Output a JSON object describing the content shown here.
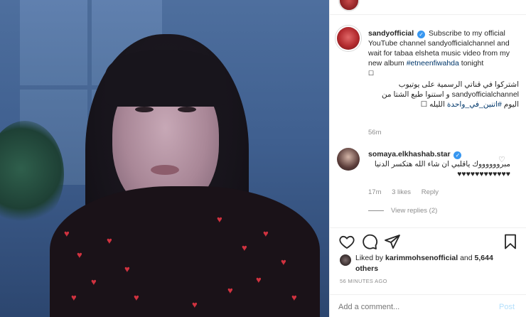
{
  "post": {
    "username": "sandyofficial",
    "caption_en": "Subscribe to my official YouTube channel sandyofficialchannel and wait for tabaa elsheta music video from my new album",
    "caption_hashtag": "#etneenfiwahda",
    "caption_after": "tonight",
    "box_glyph": "☐",
    "caption_ar_1": "اشتركوا في قناتي الرسمية على يوتيوب",
    "caption_ar_2": "sandyofficialchannel و استنوا طبع الشتا من",
    "caption_ar_3": "اليوم",
    "caption_ar_hashtag": "#اتنين_في_واحدة",
    "caption_ar_4": "الليله",
    "time_ago": "56m"
  },
  "comment": {
    "username": "somaya.elkhashab.star",
    "text": "مبرووووووك ياقلبي ان شاء الله هتكسر الدنيا",
    "hearts": "♥♥♥♥♥♥♥♥♥♥♥♥",
    "time": "17m",
    "likes": "3 likes",
    "reply": "Reply",
    "view_replies": "View replies (2)"
  },
  "likes": {
    "prefix": "Liked by",
    "user": "karimmohsenofficial",
    "and": "and",
    "others": "5,644 others"
  },
  "post_time": "56 MINUTES AGO",
  "add_comment": {
    "placeholder": "Add a comment...",
    "post_label": "Post"
  },
  "icons": {
    "like": "heart-icon",
    "comment": "comment-icon",
    "share": "share-icon",
    "save": "bookmark-icon",
    "verified": "verified-badge-icon"
  },
  "colors": {
    "link_blue": "#00376b",
    "verified_blue": "#3897f0",
    "muted_gray": "#8e8e8e",
    "post_button": "#b2dffc"
  }
}
